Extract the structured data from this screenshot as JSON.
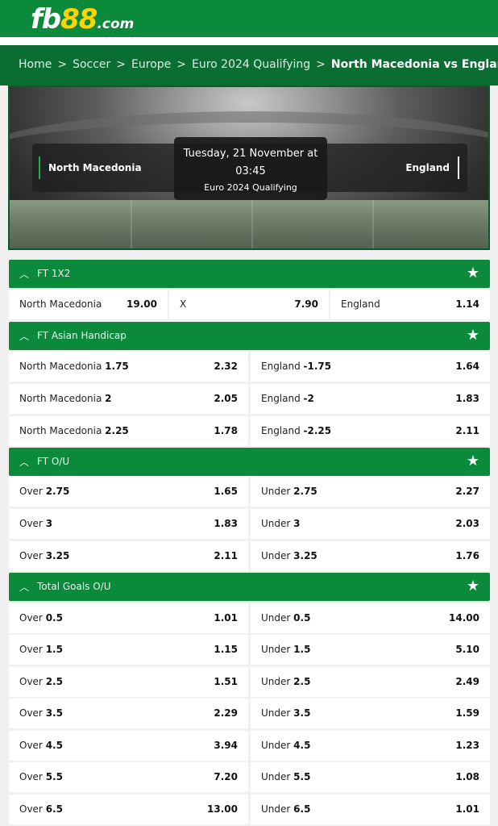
{
  "logo": {
    "fb": "fb",
    "num": "88",
    "com": ".com"
  },
  "breadcrumb": {
    "home": "Home",
    "soccer": "Soccer",
    "region": "Europe",
    "league": "Euro 2024 Qualifying",
    "current": "North Macedonia vs England",
    "separator": ">"
  },
  "match": {
    "home": "North Macedonia",
    "away": "England",
    "date": "Tuesday, 21 November at",
    "time": "03:45",
    "competition": "Euro 2024 Qualifying"
  },
  "ft1x2": {
    "title": "FT 1X2",
    "home_label": "North Macedonia",
    "home_odd": "19.00",
    "draw_label": "X",
    "draw_odd": "7.90",
    "away_label": "England",
    "away_odd": "1.14"
  },
  "asian_handicap": {
    "title": "FT Asian Handicap",
    "rows": [
      {
        "l_team": "North Macedonia",
        "l_line": "1.75",
        "l_odd": "2.32",
        "r_team": "England",
        "r_line": "-1.75",
        "r_odd": "1.64"
      },
      {
        "l_team": "North Macedonia",
        "l_line": "2",
        "l_odd": "2.05",
        "r_team": "England",
        "r_line": "-2",
        "r_odd": "1.83"
      },
      {
        "l_team": "North Macedonia",
        "l_line": "2.25",
        "l_odd": "1.78",
        "r_team": "England",
        "r_line": "-2.25",
        "r_odd": "2.11"
      }
    ]
  },
  "ft_ou": {
    "title": "FT O/U",
    "over": "Over",
    "under": "Under",
    "rows": [
      {
        "line": "2.75",
        "over_odd": "1.65",
        "under_odd": "2.27"
      },
      {
        "line": "3",
        "over_odd": "1.83",
        "under_odd": "2.03"
      },
      {
        "line": "3.25",
        "over_odd": "2.11",
        "under_odd": "1.76"
      }
    ]
  },
  "total_goals": {
    "title": "Total Goals O/U",
    "over": "Over",
    "under": "Under",
    "rows": [
      {
        "line": "0.5",
        "over_odd": "1.01",
        "under_odd": "14.00"
      },
      {
        "line": "1.5",
        "over_odd": "1.15",
        "under_odd": "5.10"
      },
      {
        "line": "2.5",
        "over_odd": "1.51",
        "under_odd": "2.49"
      },
      {
        "line": "3.5",
        "over_odd": "2.29",
        "under_odd": "1.59"
      },
      {
        "line": "4.5",
        "over_odd": "3.94",
        "under_odd": "1.23"
      },
      {
        "line": "5.5",
        "over_odd": "7.20",
        "under_odd": "1.08"
      },
      {
        "line": "6.5",
        "over_odd": "13.00",
        "under_odd": "1.01"
      }
    ]
  },
  "icons": {
    "collapse": "chevron-up-icon",
    "favorite": "star-icon"
  },
  "colors": {
    "brand_green": "#0b8a3c",
    "dark_green": "#0a6e33",
    "logo_yellow": "#ffd200"
  }
}
